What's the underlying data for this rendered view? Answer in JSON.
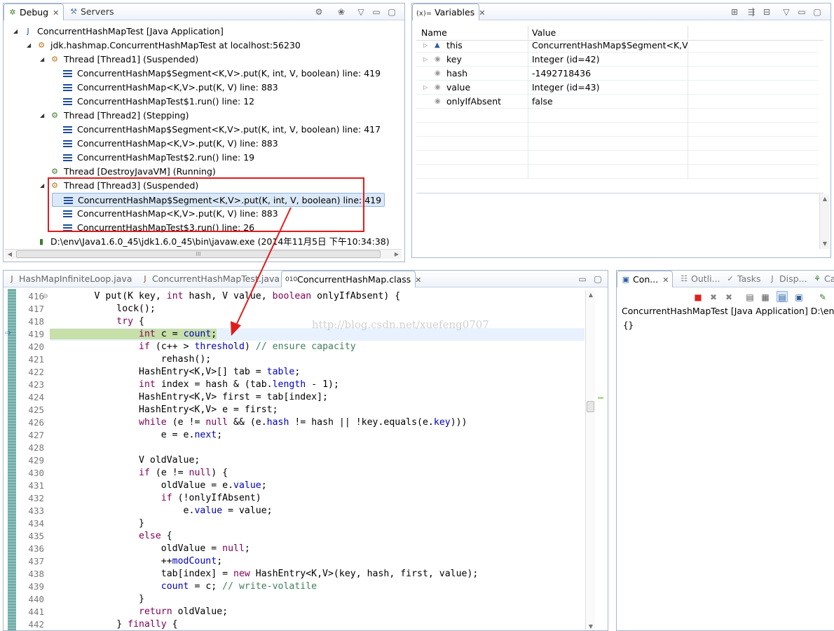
{
  "debug_view": {
    "tabs": [
      {
        "label": "Debug",
        "active": true
      },
      {
        "label": "Servers",
        "active": false
      }
    ],
    "tree": [
      {
        "level": 0,
        "twisty": "open",
        "icon": "java-application-icon",
        "text": "ConcurrentHashMapTest [Java Application]"
      },
      {
        "level": 1,
        "twisty": "open",
        "icon": "debug-target-icon",
        "text": "jdk.hashmap.ConcurrentHashMapTest at localhost:56230"
      },
      {
        "level": 2,
        "twisty": "open",
        "icon": "thread-suspended-icon",
        "text": "Thread [Thread1] (Suspended)"
      },
      {
        "level": 3,
        "twisty": "none",
        "icon": "stack-frame-icon",
        "text": "ConcurrentHashMap$Segment<K,V>.put(K, int, V, boolean) line: 419"
      },
      {
        "level": 3,
        "twisty": "none",
        "icon": "stack-frame-icon",
        "text": "ConcurrentHashMap<K,V>.put(K, V) line: 883"
      },
      {
        "level": 3,
        "twisty": "none",
        "icon": "stack-frame-icon",
        "text": "ConcurrentHashMapTest$1.run() line: 12"
      },
      {
        "level": 2,
        "twisty": "open",
        "icon": "thread-stepping-icon",
        "text": "Thread [Thread2] (Stepping)"
      },
      {
        "level": 3,
        "twisty": "none",
        "icon": "stack-frame-icon",
        "text": "ConcurrentHashMap$Segment<K,V>.put(K, int, V, boolean) line: 417"
      },
      {
        "level": 3,
        "twisty": "none",
        "icon": "stack-frame-icon",
        "text": "ConcurrentHashMap<K,V>.put(K, V) line: 883"
      },
      {
        "level": 3,
        "twisty": "none",
        "icon": "stack-frame-icon",
        "text": "ConcurrentHashMapTest$2.run() line: 19"
      },
      {
        "level": 2,
        "twisty": "none",
        "icon": "thread-running-icon",
        "text": "Thread [DestroyJavaVM] (Running)"
      },
      {
        "level": 2,
        "twisty": "open",
        "icon": "thread-suspended-icon",
        "text": "Thread [Thread3] (Suspended)"
      },
      {
        "level": 3,
        "twisty": "none",
        "icon": "stack-frame-icon",
        "text": "ConcurrentHashMap$Segment<K,V>.put(K, int, V, boolean) line: 419",
        "selected": true
      },
      {
        "level": 3,
        "twisty": "none",
        "icon": "stack-frame-icon",
        "text": "ConcurrentHashMap<K,V>.put(K, V) line: 883"
      },
      {
        "level": 3,
        "twisty": "none",
        "icon": "stack-frame-icon",
        "text": "ConcurrentHashMapTest$3.run() line: 26"
      },
      {
        "level": 1,
        "twisty": "none",
        "icon": "process-icon",
        "text": "D:\\env\\Java1.6.0_45\\jdk1.6.0_45\\bin\\javaw.exe (2014年11月5日 下午10:34:38)"
      }
    ],
    "hscroll_grip": "III"
  },
  "variables_view": {
    "tab": "Variables",
    "tab_prefix": "(x)=",
    "columns": [
      "Name",
      "Value"
    ],
    "rows": [
      {
        "twisty": true,
        "icon": "this-icon",
        "name": "this",
        "value": "ConcurrentHashMap$Segment<K,V..."
      },
      {
        "twisty": true,
        "icon": "local-icon",
        "name": "key",
        "value": "Integer  (id=42)"
      },
      {
        "twisty": false,
        "icon": "local-icon",
        "name": "hash",
        "value": "-1492718436"
      },
      {
        "twisty": true,
        "icon": "local-icon",
        "name": "value",
        "value": "Integer  (id=43)"
      },
      {
        "twisty": false,
        "icon": "local-icon",
        "name": "onlyIfAbsent",
        "value": "false"
      }
    ]
  },
  "editor": {
    "tabs": [
      {
        "label": "HashMapInfiniteLoop.java",
        "active": false
      },
      {
        "label": "ConcurrentHashMapTest.java",
        "active": false
      },
      {
        "label": "ConcurrentHashMap.class",
        "active": true
      }
    ],
    "watermark": "http://blog.csdn.net/xuefeng0707",
    "current_line": 419,
    "lines": [
      {
        "n": "416",
        "marker": "⊖",
        "tokens": [
          [
            "        ",
            "plain"
          ],
          [
            "V put(K key, ",
            "plain"
          ],
          [
            "int",
            "kw"
          ],
          [
            " hash, V value, ",
            "plain"
          ],
          [
            "boolean",
            "kw"
          ],
          [
            " onlyIfAbsent) {",
            "plain"
          ]
        ]
      },
      {
        "n": "417",
        "tokens": [
          [
            "            lock();",
            "plain"
          ]
        ]
      },
      {
        "n": "418",
        "tokens": [
          [
            "            ",
            "plain"
          ],
          [
            "try",
            "kw"
          ],
          [
            " {",
            "plain"
          ]
        ]
      },
      {
        "n": "419",
        "tokens": [
          [
            "                ",
            "plain"
          ],
          [
            "int",
            "kw"
          ],
          [
            " c = ",
            "plain"
          ],
          [
            "count",
            "fld"
          ],
          [
            ";",
            "plain"
          ]
        ]
      },
      {
        "n": "420",
        "tokens": [
          [
            "                ",
            "plain"
          ],
          [
            "if",
            "kw"
          ],
          [
            " (c++ > ",
            "plain"
          ],
          [
            "threshold",
            "fld"
          ],
          [
            ") ",
            "plain"
          ],
          [
            "// ensure capacity",
            "cmt"
          ]
        ]
      },
      {
        "n": "421",
        "tokens": [
          [
            "                    rehash();",
            "plain"
          ]
        ]
      },
      {
        "n": "422",
        "tokens": [
          [
            "                HashEntry<K,V>[] tab = ",
            "plain"
          ],
          [
            "table",
            "fld"
          ],
          [
            ";",
            "plain"
          ]
        ]
      },
      {
        "n": "423",
        "tokens": [
          [
            "                ",
            "plain"
          ],
          [
            "int",
            "kw"
          ],
          [
            " index = hash & (tab.",
            "plain"
          ],
          [
            "length",
            "fld"
          ],
          [
            " - 1);",
            "plain"
          ]
        ]
      },
      {
        "n": "424",
        "tokens": [
          [
            "                HashEntry<K,V> first = tab[index];",
            "plain"
          ]
        ]
      },
      {
        "n": "425",
        "tokens": [
          [
            "                HashEntry<K,V> e = first;",
            "plain"
          ]
        ]
      },
      {
        "n": "426",
        "tokens": [
          [
            "                ",
            "plain"
          ],
          [
            "while",
            "kw"
          ],
          [
            " (e != ",
            "plain"
          ],
          [
            "null",
            "kw"
          ],
          [
            " && (e.",
            "plain"
          ],
          [
            "hash",
            "fld"
          ],
          [
            " != hash || !key.equals(e.",
            "plain"
          ],
          [
            "key",
            "fld"
          ],
          [
            ")))",
            "plain"
          ]
        ]
      },
      {
        "n": "427",
        "tokens": [
          [
            "                    e = e.",
            "plain"
          ],
          [
            "next",
            "fld"
          ],
          [
            ";",
            "plain"
          ]
        ]
      },
      {
        "n": "428",
        "tokens": [
          [
            "",
            "plain"
          ]
        ]
      },
      {
        "n": "429",
        "tokens": [
          [
            "                V oldValue;",
            "plain"
          ]
        ]
      },
      {
        "n": "430",
        "tokens": [
          [
            "                ",
            "plain"
          ],
          [
            "if",
            "kw"
          ],
          [
            " (e != ",
            "plain"
          ],
          [
            "null",
            "kw"
          ],
          [
            ") {",
            "plain"
          ]
        ]
      },
      {
        "n": "431",
        "tokens": [
          [
            "                    oldValue = e.",
            "plain"
          ],
          [
            "value",
            "fld"
          ],
          [
            ";",
            "plain"
          ]
        ]
      },
      {
        "n": "432",
        "tokens": [
          [
            "                    ",
            "plain"
          ],
          [
            "if",
            "kw"
          ],
          [
            " (!onlyIfAbsent)",
            "plain"
          ]
        ]
      },
      {
        "n": "433",
        "tokens": [
          [
            "                        e.",
            "plain"
          ],
          [
            "value",
            "fld"
          ],
          [
            " = value;",
            "plain"
          ]
        ]
      },
      {
        "n": "434",
        "tokens": [
          [
            "                }",
            "plain"
          ]
        ]
      },
      {
        "n": "435",
        "tokens": [
          [
            "                ",
            "plain"
          ],
          [
            "else",
            "kw"
          ],
          [
            " {",
            "plain"
          ]
        ]
      },
      {
        "n": "436",
        "tokens": [
          [
            "                    oldValue = ",
            "plain"
          ],
          [
            "null",
            "kw"
          ],
          [
            ";",
            "plain"
          ]
        ]
      },
      {
        "n": "437",
        "tokens": [
          [
            "                    ++",
            "plain"
          ],
          [
            "modCount",
            "fld"
          ],
          [
            ";",
            "plain"
          ]
        ]
      },
      {
        "n": "438",
        "tokens": [
          [
            "                    tab[index] = ",
            "plain"
          ],
          [
            "new",
            "kw"
          ],
          [
            " HashEntry<K,V>(key, hash, first, value);",
            "plain"
          ]
        ]
      },
      {
        "n": "439",
        "tokens": [
          [
            "                    ",
            "plain"
          ],
          [
            "count",
            "fld"
          ],
          [
            " = c; ",
            "plain"
          ],
          [
            "// write-volatile",
            "cmt"
          ]
        ]
      },
      {
        "n": "440",
        "tokens": [
          [
            "                }",
            "plain"
          ]
        ]
      },
      {
        "n": "441",
        "tokens": [
          [
            "                ",
            "plain"
          ],
          [
            "return",
            "kw"
          ],
          [
            " oldValue;",
            "plain"
          ]
        ]
      },
      {
        "n": "442",
        "tokens": [
          [
            "            } ",
            "plain"
          ],
          [
            "finally",
            "kw"
          ],
          [
            " {",
            "plain"
          ]
        ]
      }
    ]
  },
  "console_view": {
    "tabs": [
      {
        "label": "Con...",
        "active": true
      },
      {
        "label": "Outli...",
        "active": false
      },
      {
        "label": "Tasks",
        "active": false
      },
      {
        "label": "Disp...",
        "active": false
      },
      {
        "label": "Cal",
        "active": false
      }
    ],
    "title": "ConcurrentHashMapTest [Java Application] D:\\env\\Ja",
    "output": "{}"
  },
  "colors": {
    "highlight_box": "#e21b1b",
    "current_line_bg": "#c7dfa8",
    "keyword": "#7f0055",
    "field": "#0000c0",
    "comment": "#3f7f5f"
  }
}
